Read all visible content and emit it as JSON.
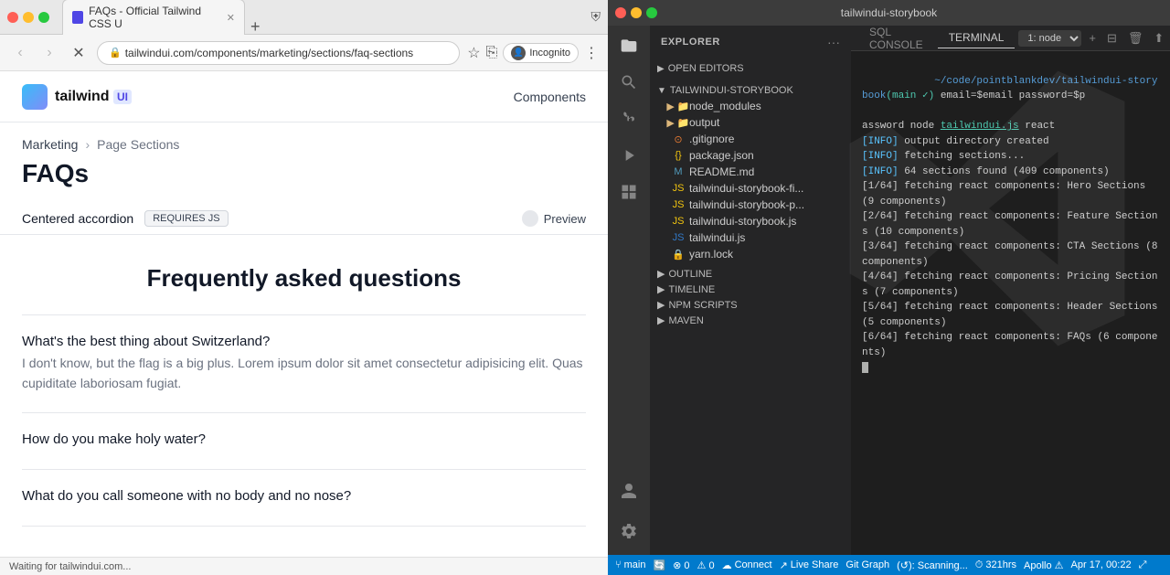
{
  "browser": {
    "tab_title": "FAQs - Official Tailwind CSS U",
    "url": "tailwindui.com/components/marketing/sections/faq-sections",
    "incognito_label": "Incognito",
    "status_bar": "Waiting for tailwindui.com...",
    "nav": {
      "logo_text": "tailwind",
      "components_label": "Components"
    },
    "breadcrumb": {
      "marketing": "Marketing",
      "separator": ">",
      "page_sections": "Page Sections"
    },
    "page_title": "FAQs",
    "section_label": "Centered accordion",
    "requires_js": "REQUIRES JS",
    "preview_label": "Preview",
    "faq_main_title": "Frequently asked questions",
    "faq_items": [
      {
        "question": "What's the best thing about Switzerland?",
        "answer": "I don't know, but the flag is a big plus. Lorem ipsum dolor sit amet consectetur adipisicing elit. Quas cupiditate laboriosam fugiat."
      },
      {
        "question": "How do you make holy water?",
        "answer": ""
      },
      {
        "question": "What do you call someone with no body and no nose?",
        "answer": ""
      }
    ]
  },
  "vscode": {
    "window_title": "tailwindui-storybook",
    "sidebar": {
      "title": "EXPLORER",
      "open_editors": "OPEN EDITORS",
      "project": "TAILWINDUI-STORYBOOK",
      "files": [
        {
          "name": "node_modules",
          "type": "folder"
        },
        {
          "name": "output",
          "type": "folder"
        },
        {
          "name": ".gitignore",
          "type": "git"
        },
        {
          "name": "package.json",
          "type": "json"
        },
        {
          "name": "README.md",
          "type": "md"
        },
        {
          "name": "tailwindui-storybook-fi...",
          "type": "js"
        },
        {
          "name": "tailwindui-storybook-p...",
          "type": "js"
        },
        {
          "name": "tailwindui-storybook.js",
          "type": "js"
        },
        {
          "name": "tailwindui.js",
          "type": "ts"
        },
        {
          "name": "yarn.lock",
          "type": "lock"
        }
      ],
      "outline": "OUTLINE",
      "timeline": "TIMELINE",
      "npm_scripts": "NPM SCRIPTS",
      "maven": "MAVEN"
    },
    "terminal": {
      "tabs": [
        "SQL CONSOLE",
        "TERMINAL"
      ],
      "active_tab": "TERMINAL",
      "instance": "1: node",
      "lines": [
        "~/code/pointblankdev/tailwindui-storybook(main ✓) email=$email password=$p",
        "assword node tailwindui.js react",
        "[INFO] output directory created",
        "[INFO] fetching sections...",
        "[INFO] 64 sections found (409 components)",
        "[1/64] fetching react components: Hero Sections (9 components)",
        "[2/64] fetching react components: Feature Sections (10 components)",
        "[3/64] fetching react components: CTA Sections (8 components)",
        "[4/64] fetching react components: Pricing Sections (7 components)",
        "[5/64] fetching react components: Header Sections (5 components)",
        "[6/64] fetching react components: FAQs (6 components)"
      ]
    },
    "statusbar": {
      "branch": "main",
      "errors": "⊗ 0",
      "warnings": "⚠ 0",
      "connect": "Connect",
      "live_share": "Live Share",
      "git_graph": "Git Graph",
      "scanning": "(↺): Scanning...",
      "time_label": "321hrs",
      "apollo": "Apollo ⚠",
      "date": "Apr 17, 00:22"
    }
  }
}
